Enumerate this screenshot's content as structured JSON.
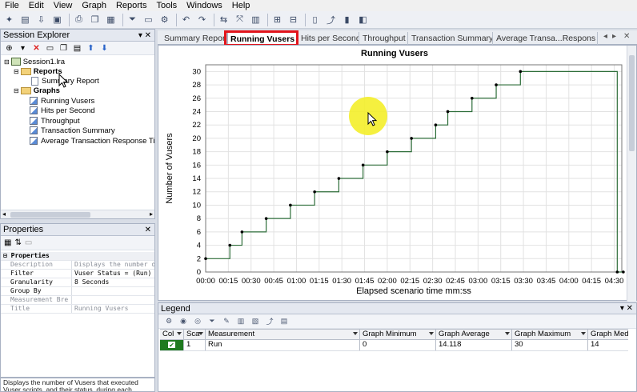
{
  "menu": [
    "File",
    "Edit",
    "View",
    "Graph",
    "Reports",
    "Tools",
    "Windows",
    "Help"
  ],
  "session_explorer": {
    "title": "Session Explorer",
    "root": "Session1.lra",
    "reports_folder": "Reports",
    "report_item": "Summary Report",
    "graphs_folder": "Graphs",
    "graphs": [
      "Running Vusers",
      "Hits per Second",
      "Throughput",
      "Transaction Summary",
      "Average Transaction Response Ti"
    ]
  },
  "properties": {
    "title": "Properties",
    "section": "Properties",
    "rows": [
      {
        "key": "Description",
        "value": "Displays the number o",
        "gray": true
      },
      {
        "key": "Filter",
        "value": "Vuser Status = (Run)",
        "gray": false
      },
      {
        "key": "Granularity",
        "value": "8 Seconds",
        "gray": false
      },
      {
        "key": "Group By",
        "value": "",
        "gray": false
      },
      {
        "key": "Measurement Bre",
        "value": "",
        "gray": true
      },
      {
        "key": "Title",
        "value": "Running Vusers",
        "gray": true
      }
    ]
  },
  "status_text": "Displays the number of Vusers that executed Vuser scripts, and their status, during each second",
  "tabs": [
    "Summary Report",
    "Running Vusers",
    "Hits per Second",
    "Throughput",
    "Transaction Summary",
    "Average Transa...Respons"
  ],
  "active_tab": "Running Vusers",
  "chart_data": {
    "type": "line",
    "title": "Running Vusers",
    "xlabel": "Elapsed scenario time mm:ss",
    "ylabel": "Number of Vusers",
    "x_ticks": [
      "00:00",
      "00:15",
      "00:30",
      "00:45",
      "01:00",
      "01:15",
      "01:30",
      "01:45",
      "02:00",
      "02:15",
      "02:30",
      "02:45",
      "03:00",
      "03:15",
      "03:30",
      "03:45",
      "04:00",
      "04:15",
      "04:30"
    ],
    "y_ticks": [
      0,
      2,
      4,
      6,
      8,
      10,
      12,
      14,
      16,
      18,
      20,
      22,
      24,
      26,
      28,
      30
    ],
    "ylim": [
      0,
      31
    ],
    "xlim_seconds": [
      0,
      275
    ],
    "grid": true,
    "series": [
      {
        "name": "Run",
        "step": true,
        "points": [
          {
            "x": "00:00",
            "y": 2
          },
          {
            "x": "00:16",
            "y": 4
          },
          {
            "x": "00:24",
            "y": 6
          },
          {
            "x": "00:40",
            "y": 8
          },
          {
            "x": "00:56",
            "y": 10
          },
          {
            "x": "01:12",
            "y": 12
          },
          {
            "x": "01:28",
            "y": 14
          },
          {
            "x": "01:44",
            "y": 16
          },
          {
            "x": "02:00",
            "y": 18
          },
          {
            "x": "02:16",
            "y": 20
          },
          {
            "x": "02:32",
            "y": 22
          },
          {
            "x": "02:40",
            "y": 24
          },
          {
            "x": "02:56",
            "y": 26
          },
          {
            "x": "03:12",
            "y": 28
          },
          {
            "x": "03:28",
            "y": 30
          },
          {
            "x": "04:32",
            "y": 0
          },
          {
            "x": "04:36",
            "y": 0
          }
        ]
      }
    ]
  },
  "legend": {
    "title": "Legend",
    "columns": [
      "Col",
      "Sca",
      "Measurement",
      "Graph Minimum",
      "Graph Average",
      "Graph Maximum",
      "Graph Med"
    ],
    "rows": [
      {
        "checked": true,
        "scale": "1",
        "measurement": "Run",
        "min": "0",
        "avg": "14.118",
        "max": "30",
        "med": "14"
      }
    ]
  },
  "colors": {
    "line": "#2e6e3a",
    "highlight": "#e2141b",
    "cursor_halo": "#f4ee2a"
  }
}
